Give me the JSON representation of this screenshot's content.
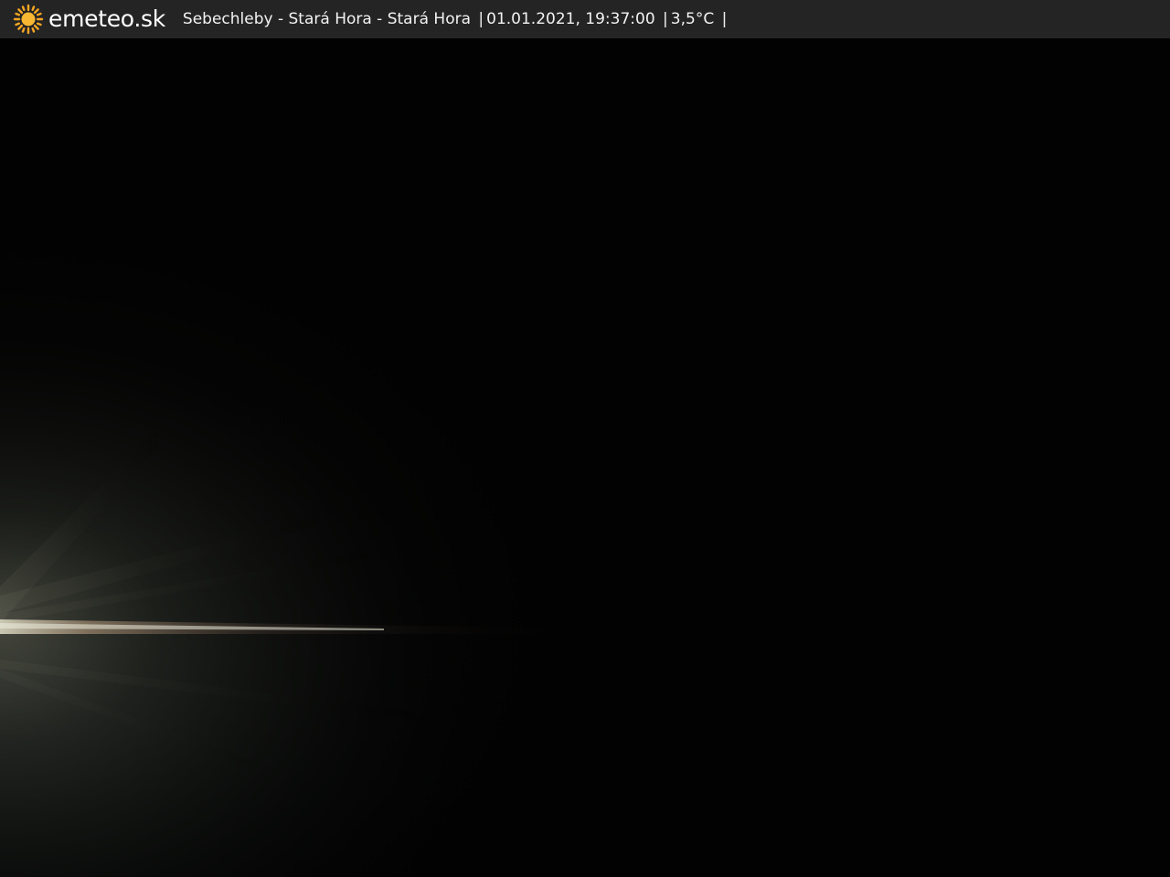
{
  "header": {
    "brand": "emeteo.sk",
    "location": "Sebechleby - Stará Hora - Stará Hora",
    "datetime": "01.01.2021, 19:37:00",
    "temperature": "3,5°C",
    "separator": "|"
  },
  "icons": {
    "logo": "sun-icon"
  },
  "colors": {
    "bar_background": "#242424",
    "sun": "#f5a623",
    "sky": "#020202"
  }
}
